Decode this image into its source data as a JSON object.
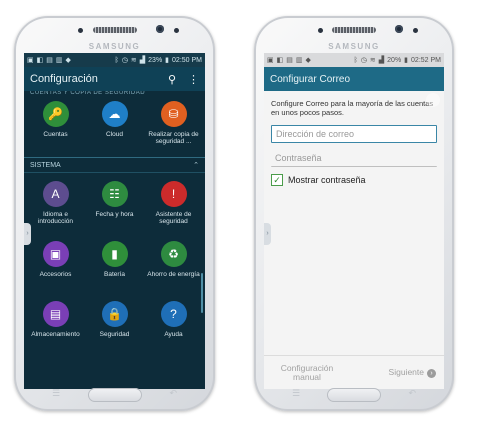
{
  "phone_left": {
    "brand": "SAMSUNG",
    "status": {
      "time": "02:50 PM",
      "battery": "23%"
    },
    "appbar": {
      "title": "Configuración",
      "search_icon": "search-icon",
      "menu_icon": "more-vertical-icon"
    },
    "cut_label": "CUENTAS Y COPIA DE SEGURIDAD",
    "top_items": [
      {
        "label": "Cuentas",
        "icon": "key-icon",
        "color": "#2f8f3a"
      },
      {
        "label": "Cloud",
        "icon": "cloud-icon",
        "color": "#1f7fc7"
      },
      {
        "label": "Realizar copia de seguridad ...",
        "icon": "backup-icon",
        "color": "#e06020"
      }
    ],
    "section": {
      "label": "SISTEMA",
      "chevron": "chevron-up-icon"
    },
    "system_items": [
      {
        "label": "Idioma e introducción",
        "icon": "keyboard-icon",
        "color": "#5d4d8f"
      },
      {
        "label": "Fecha y hora",
        "icon": "calendar-icon",
        "color": "#2e8b40"
      },
      {
        "label": "Asistente de seguridad",
        "icon": "alert-icon",
        "color": "#cc2b2b"
      },
      {
        "label": "Accesorios",
        "icon": "accessory-icon",
        "color": "#7a3fb6"
      },
      {
        "label": "Batería",
        "icon": "battery-icon",
        "color": "#2f8f3a"
      },
      {
        "label": "Ahorro de energía",
        "icon": "leaf-battery-icon",
        "color": "#2e8b40"
      },
      {
        "label": "Almacenamiento",
        "icon": "storage-icon",
        "color": "#7a3fb6"
      },
      {
        "label": "Seguridad",
        "icon": "lock-icon",
        "color": "#1f6fb7"
      },
      {
        "label": "Ayuda",
        "icon": "help-icon",
        "color": "#1f6fb7"
      }
    ]
  },
  "phone_right": {
    "brand": "SAMSUNG",
    "status": {
      "time": "02:52 PM",
      "battery": "20%"
    },
    "appbar": {
      "title": "Configurar Correo"
    },
    "description": "Configure Correo para la mayoría de las cuentas en unos pocos pasos.",
    "email_field": {
      "placeholder": "Dirección de correo"
    },
    "password_field": {
      "placeholder": "Contraseña"
    },
    "show_password": {
      "label": "Mostrar contraseña",
      "checked": true
    },
    "footer": {
      "manual_label": "Configuración manual",
      "next_label": "Siguiente"
    }
  }
}
